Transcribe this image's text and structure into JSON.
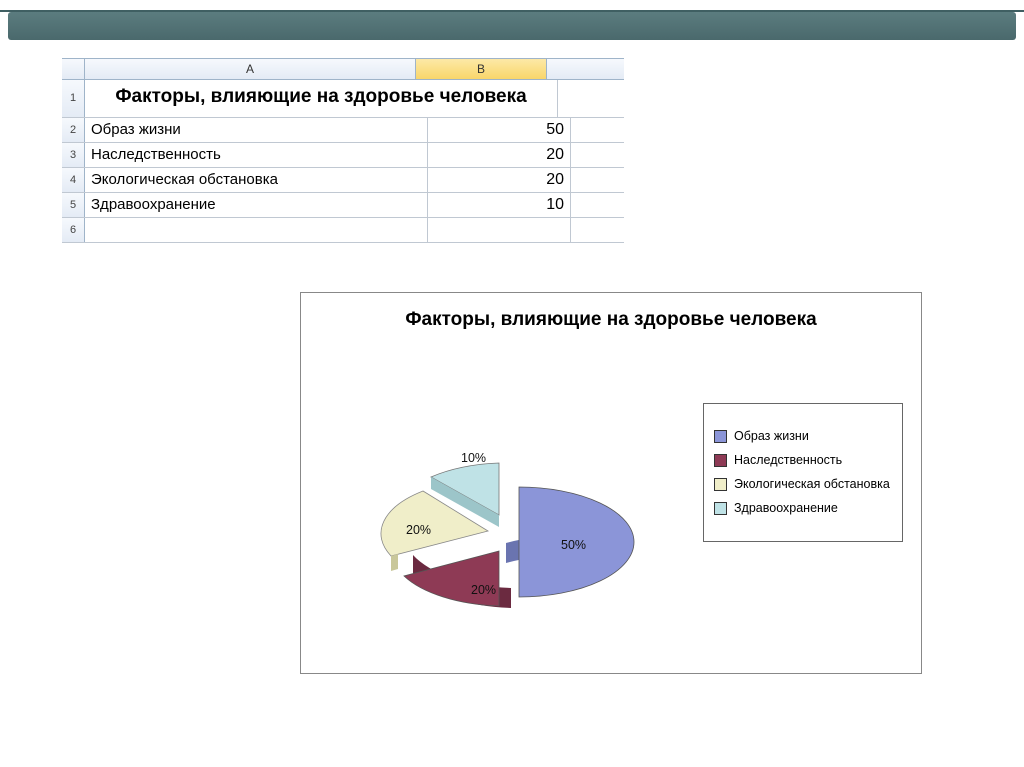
{
  "spreadsheet": {
    "colA_header": "A",
    "colB_header": "B",
    "title": "Факторы, влияющие на здоровье человека",
    "rows": [
      {
        "n": "1"
      },
      {
        "n": "2",
        "a": "Образ жизни",
        "b": "50"
      },
      {
        "n": "3",
        "a": "Наследственность",
        "b": "20"
      },
      {
        "n": "4",
        "a": "Экологическая обстановка",
        "b": "20"
      },
      {
        "n": "5",
        "a": "Здравоохранение",
        "b": "10"
      },
      {
        "n": "6",
        "a": "",
        "b": ""
      }
    ]
  },
  "chart": {
    "title": "Факторы, влияющие на здоровье человека",
    "legend": {
      "s0": "Образ жизни",
      "s1": "Наследственность",
      "s2": "Экологическая обстановка",
      "s3": "Здравоохранение"
    },
    "labels": {
      "l0": "50%",
      "l1": "20%",
      "l2": "20%",
      "l3": "10%"
    }
  },
  "chart_data": {
    "type": "pie",
    "title": "Факторы, влияющие на здоровье человека",
    "series": [
      {
        "name": "Образ жизни",
        "value": 50,
        "color": "#8b95d8"
      },
      {
        "name": "Наследственность",
        "value": 20,
        "color": "#8e3a55"
      },
      {
        "name": "Экологическая обстановка",
        "value": 20,
        "color": "#f0eec9"
      },
      {
        "name": "Здравоохранение",
        "value": 10,
        "color": "#bfe2e6"
      }
    ],
    "style": "3d-exploded",
    "data_labels": "percent"
  }
}
